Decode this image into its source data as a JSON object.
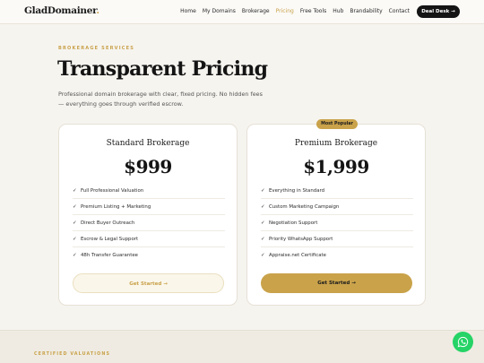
{
  "header": {
    "logo": "GladDomainer",
    "logo_dot": ".",
    "nav": [
      "Home",
      "My Domains",
      "Brokerage",
      "Pricing",
      "Free Tools",
      "Hub",
      "Brandability",
      "Contact"
    ],
    "active_nav": "Pricing",
    "deal_desk": "Deal Desk →"
  },
  "hero": {
    "eyebrow": "BROKERAGE SERVICES",
    "title": "Transparent Pricing",
    "description": "Professional domain brokerage with clear, fixed pricing. No hidden fees — everything goes through verified escrow."
  },
  "plans": [
    {
      "name": "Standard Brokerage",
      "price": "$999",
      "features": [
        "Full Professional Valuation",
        "Premium Listing + Marketing",
        "Direct Buyer Outreach",
        "Escrow & Legal Support",
        "48h Transfer Guarantee"
      ],
      "cta": "Get Started →"
    },
    {
      "badge": "Most Popular",
      "name": "Premium Brokerage",
      "price": "$1,999",
      "features": [
        "Everything in Standard",
        "Custom Marketing Campaign",
        "Negotiation Support",
        "Priority WhatsApp Support",
        "Appraise.net Certificate"
      ],
      "cta": "Get Started →"
    }
  ],
  "footer_band": {
    "eyebrow": "CERTIFIED VALUATIONS"
  },
  "colors": {
    "accent": "#c9a24a",
    "dark": "#141414",
    "background": "#f6f4ef",
    "whatsapp": "#25d366"
  },
  "icons": {
    "feature": "check-icon",
    "chat": "whatsapp-icon"
  }
}
